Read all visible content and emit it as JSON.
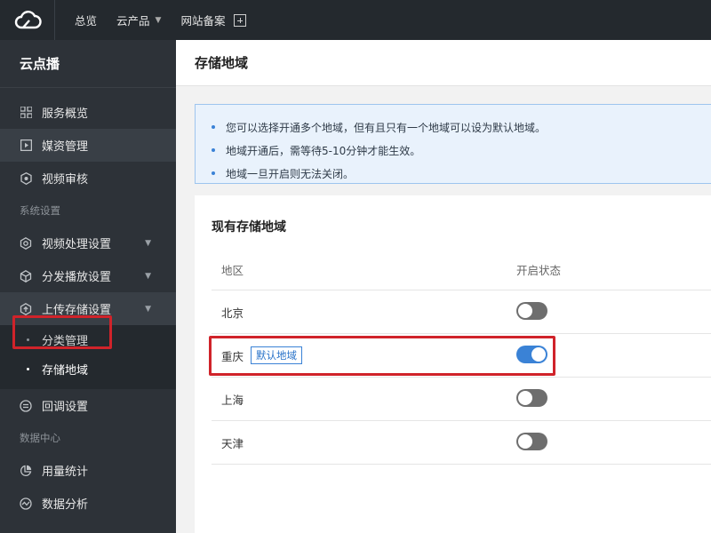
{
  "topbar": {
    "logo_icon": "cloud-logo-icon",
    "nav": [
      {
        "label": "总览",
        "has_caret": false
      },
      {
        "label": "云产品",
        "has_caret": true
      },
      {
        "label": "网站备案",
        "has_caret": false
      }
    ]
  },
  "sidebar": {
    "title": "云点播",
    "items_top": [
      {
        "label": "服务概览",
        "icon": "grid-icon"
      },
      {
        "label": "媒资管理",
        "icon": "play-icon"
      },
      {
        "label": "视频审核",
        "icon": "shield-icon"
      }
    ],
    "group_settings": "系统设置",
    "settings_items": [
      {
        "label": "视频处理设置",
        "icon": "process-icon"
      },
      {
        "label": "分发播放设置",
        "icon": "cube-icon"
      },
      {
        "label": "上传存储设置",
        "icon": "upload-icon"
      }
    ],
    "sub_items": [
      {
        "label": "分类管理"
      },
      {
        "label": "存储地域"
      }
    ],
    "callback_item": {
      "label": "回调设置",
      "icon": "callback-icon"
    },
    "group_data": "数据中心",
    "data_items": [
      {
        "label": "用量统计",
        "icon": "pie-chart-icon"
      },
      {
        "label": "数据分析",
        "icon": "analytics-icon"
      }
    ]
  },
  "main": {
    "page_title": "存储地域",
    "notices": [
      "您可以选择开通多个地域，但有且只有一个地域可以设为默认地域。",
      "地域开通后，需等待5-10分钟才能生效。",
      "地域一旦开启则无法关闭。"
    ],
    "card_title": "现有存储地域",
    "columns": [
      "地区",
      "开启状态"
    ],
    "rows": [
      {
        "region": "北京",
        "default_badge": "",
        "enabled": false
      },
      {
        "region": "重庆",
        "default_badge": "默认地域",
        "enabled": true
      },
      {
        "region": "上海",
        "default_badge": "",
        "enabled": false
      },
      {
        "region": "天津",
        "default_badge": "",
        "enabled": false
      }
    ]
  },
  "colors": {
    "topbar_bg": "#24292e",
    "sidebar_bg": "#2d3238",
    "accent": "#3a82d6",
    "highlight_border": "#d0232a"
  }
}
